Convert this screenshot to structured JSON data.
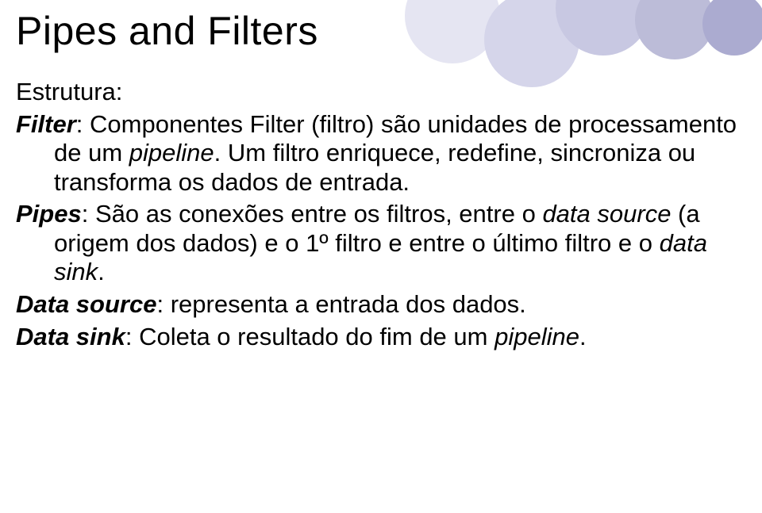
{
  "title": "Pipes and Filters",
  "section_label": "Estrutura:",
  "filter": {
    "term": "Filter",
    "text_part1": ": Componentes Filter (filtro) são unidades de processamento de um ",
    "italic1": "pipeline",
    "text_part2": ". Um filtro enriquece, redefine, sincroniza ou transforma os dados de entrada."
  },
  "pipes": {
    "term": "Pipes",
    "text_part1": ": São as conexões entre os filtros, entre o ",
    "italic1": "data source",
    "text_part2": " (a origem dos dados) e o 1º filtro e entre o último filtro e o ",
    "italic2": "data sink",
    "text_part3": "."
  },
  "data_source": {
    "term": "Data source",
    "text": ": representa a entrada dos dados."
  },
  "data_sink": {
    "term": "Data sink",
    "text_part1": ": Coleta o resultado do fim de um ",
    "italic1": "pipeline",
    "text_part2": "."
  }
}
